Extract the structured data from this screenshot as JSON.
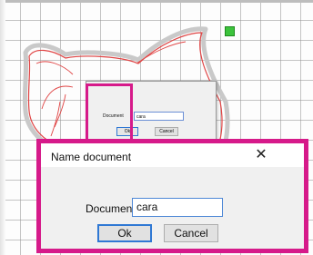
{
  "canvas": {
    "grid_color": "#9a9a9a",
    "highlight_color": "#d61a8a",
    "handle_color": "#3cc33c"
  },
  "small_dialog": {
    "document_label": "Document",
    "document_value": "cara",
    "ok_label": "Ok",
    "cancel_label": "Cancel"
  },
  "dialog": {
    "title": "Name document",
    "close_glyph": "✕",
    "document_label": "Document",
    "document_value": "cara",
    "ok_label": "Ok",
    "cancel_label": "Cancel"
  }
}
